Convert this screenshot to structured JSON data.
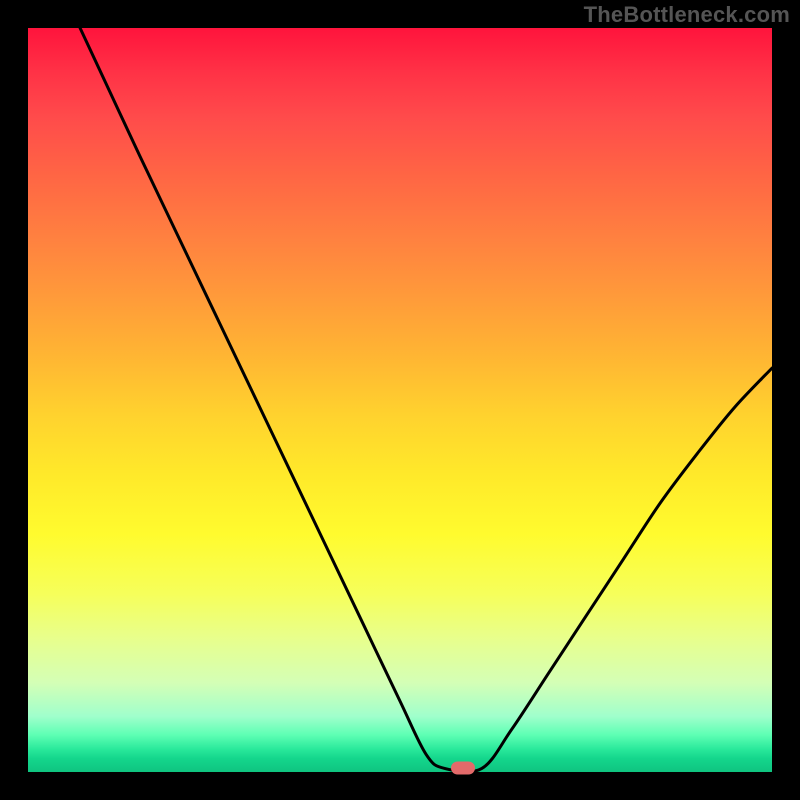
{
  "watermark": "TheBottleneck.com",
  "colors": {
    "frame_bg": "#000000",
    "curve_stroke": "#000000",
    "marker_fill": "#e36a6a"
  },
  "chart_data": {
    "type": "line",
    "title": "",
    "xlabel": "",
    "ylabel": "",
    "xlim": [
      0,
      100
    ],
    "ylim": [
      0,
      105
    ],
    "grid": false,
    "legend": false,
    "curve_left": {
      "name": "left",
      "x": [
        7,
        11,
        15,
        20,
        25,
        30,
        35,
        40,
        45,
        50,
        53.5,
        56
      ],
      "y": [
        105,
        96,
        87,
        76,
        65,
        54,
        43,
        32,
        21,
        10,
        2.5,
        0.5
      ]
    },
    "curve_flat": {
      "name": "flat",
      "x": [
        56,
        61
      ],
      "y": [
        0.5,
        0.5
      ]
    },
    "curve_right": {
      "name": "right",
      "x": [
        61,
        65,
        70,
        75,
        80,
        85,
        90,
        95,
        100
      ],
      "y": [
        0.5,
        6,
        14,
        22,
        30,
        38,
        45,
        51.5,
        57
      ]
    },
    "marker": {
      "x": 58.5,
      "y": 0.5
    }
  }
}
